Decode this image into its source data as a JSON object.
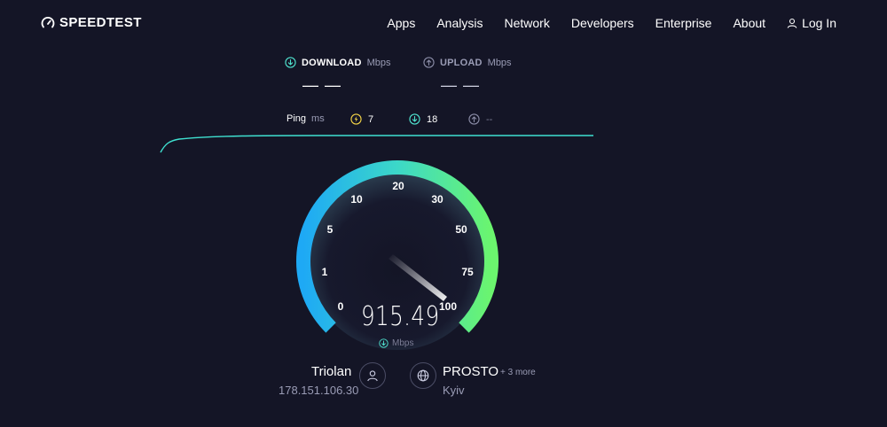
{
  "header": {
    "logo_text": "SPEEDTEST",
    "nav": [
      "Apps",
      "Analysis",
      "Network",
      "Developers",
      "Enterprise",
      "About"
    ],
    "login_label": "Log In"
  },
  "results": {
    "download": {
      "label": "DOWNLOAD",
      "unit": "Mbps",
      "value": "— —"
    },
    "upload": {
      "label": "UPLOAD",
      "unit": "Mbps",
      "value": "— —"
    }
  },
  "ping": {
    "label": "Ping",
    "unit": "ms",
    "idle": "7",
    "download": "18",
    "upload": "--"
  },
  "gauge": {
    "ticks": [
      "0",
      "1",
      "5",
      "10",
      "20",
      "30",
      "50",
      "75",
      "100"
    ],
    "speed": "915.49",
    "unit": "Mbps",
    "colors": {
      "start": "#1ea9f5",
      "mid": "#3cd8c8",
      "end": "#6bf56e"
    }
  },
  "isp": {
    "name": "Triolan",
    "ip": "178.151.106.30"
  },
  "server": {
    "name": "PROSTO",
    "more": "+ 3 more",
    "city": "Kyiv"
  },
  "icons": {
    "logo": "speedometer-icon",
    "login": "user-icon",
    "download": "arrow-down-circle-icon",
    "upload": "arrow-up-circle-icon",
    "ping_idle": "lightning-icon",
    "isp": "user-icon",
    "server": "globe-icon"
  }
}
